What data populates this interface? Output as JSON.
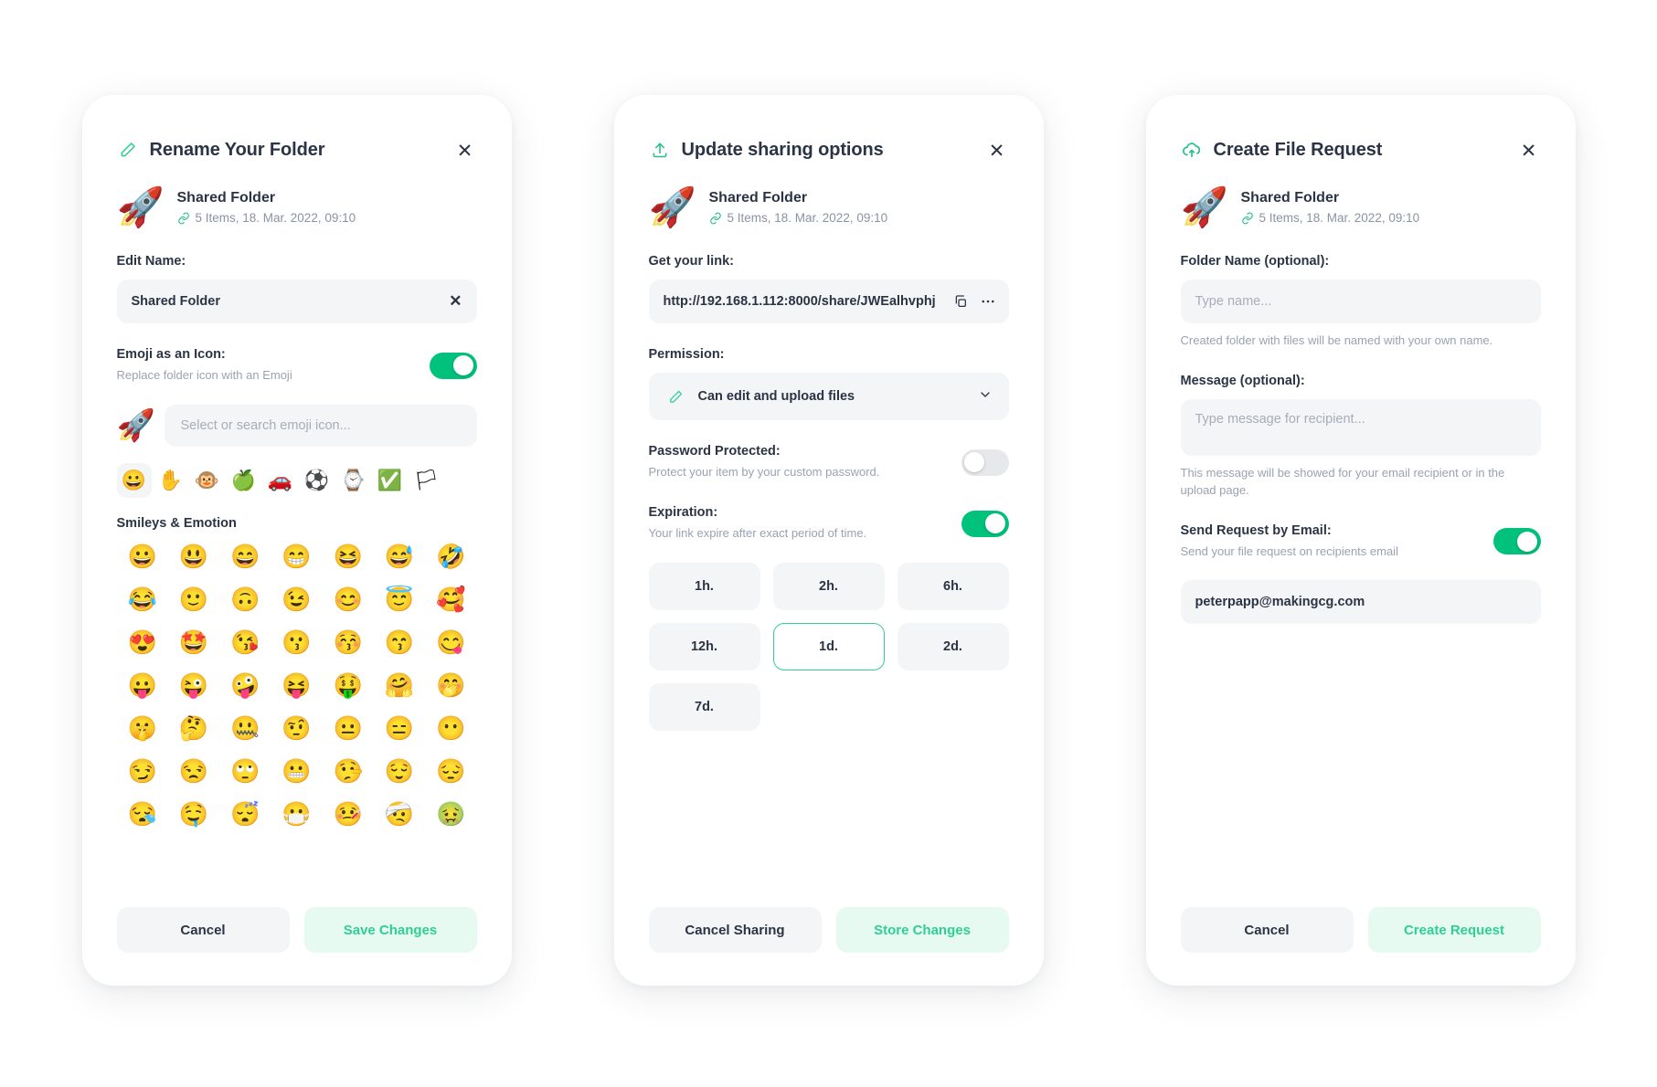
{
  "colors": {
    "accent": "#00c27c",
    "accent_soft": "#e7faf1",
    "accent_text": "#2fcf94",
    "text": "#2b3445",
    "muted": "#9aa2b1",
    "field": "#f4f5f7"
  },
  "shared_file": {
    "emoji": "🚀",
    "name": "Shared Folder",
    "meta": "5 Items, 18. Mar. 2022, 09:10"
  },
  "rename_panel": {
    "title": "Rename Your Folder",
    "header_icon": "pencil-icon",
    "close_label": "✕",
    "edit_name_label": "Edit Name:",
    "name_value": "Shared Folder",
    "clear_label": "✕",
    "emoji_toggle_label": "Emoji as an Icon:",
    "emoji_toggle_sub": "Replace folder icon with an Emoji",
    "emoji_toggle_state": "on",
    "current_emoji": "🚀",
    "emoji_search_placeholder": "Select or search emoji icon...",
    "categories": [
      "😀",
      "✋",
      "🐵",
      "🍏",
      "🚗",
      "⚽",
      "⌚",
      "✅",
      "🏳"
    ],
    "active_category_index": 0,
    "group_title": "Smileys & Emotion",
    "emojis": [
      "😀",
      "😃",
      "😄",
      "😁",
      "😆",
      "😅",
      "🤣",
      "😂",
      "🙂",
      "🙃",
      "😉",
      "😊",
      "😇",
      "🥰",
      "😍",
      "🤩",
      "😘",
      "😗",
      "😚",
      "😙",
      "😋",
      "😛",
      "😜",
      "🤪",
      "😝",
      "🤑",
      "🤗",
      "🤭",
      "🤫",
      "🤔",
      "🤐",
      "🤨",
      "😐",
      "😑",
      "😶",
      "😏",
      "😒",
      "🙄",
      "😬",
      "🤥",
      "😌",
      "😔",
      "😪",
      "🤤",
      "😴",
      "😷",
      "🤒",
      "🤕",
      "🤢"
    ],
    "cancel_label": "Cancel",
    "save_label": "Save Changes"
  },
  "sharing_panel": {
    "title": "Update sharing options",
    "header_icon": "upload-icon",
    "close_label": "✕",
    "link_label": "Get your link:",
    "link_value": "http://192.168.1.112:8000/share/JWEalhvphj",
    "copy_icon": "copy-icon",
    "more_icon": "more-icon",
    "permission_label": "Permission:",
    "permission_value": "Can edit and upload files",
    "permission_icon": "pencil-icon",
    "password_label": "Password Protected:",
    "password_sub": "Protect your item by your custom password.",
    "password_state": "off",
    "expiration_label": "Expiration:",
    "expiration_sub": "Your link expire after exact period of time.",
    "expiration_state": "on",
    "expiration_options": [
      "1h.",
      "2h.",
      "6h.",
      "12h.",
      "1d.",
      "2d.",
      "7d."
    ],
    "expiration_selected": "1d.",
    "cancel_label": "Cancel Sharing",
    "save_label": "Store Changes"
  },
  "request_panel": {
    "title": "Create File Request",
    "header_icon": "cloud-upload-icon",
    "close_label": "✕",
    "folder_name_label": "Folder Name (optional):",
    "folder_name_placeholder": "Type name...",
    "folder_name_help": "Created folder with files will be named with your own name.",
    "message_label": "Message (optional):",
    "message_placeholder": "Type message for recipient...",
    "message_help": "This message will be showed for your email recipient or in the upload page.",
    "email_toggle_label": "Send Request by Email:",
    "email_toggle_sub": "Send your file request on recipients email",
    "email_toggle_state": "on",
    "email_value": "peterpapp@makingcg.com",
    "cancel_label": "Cancel",
    "submit_label": "Create Request"
  }
}
